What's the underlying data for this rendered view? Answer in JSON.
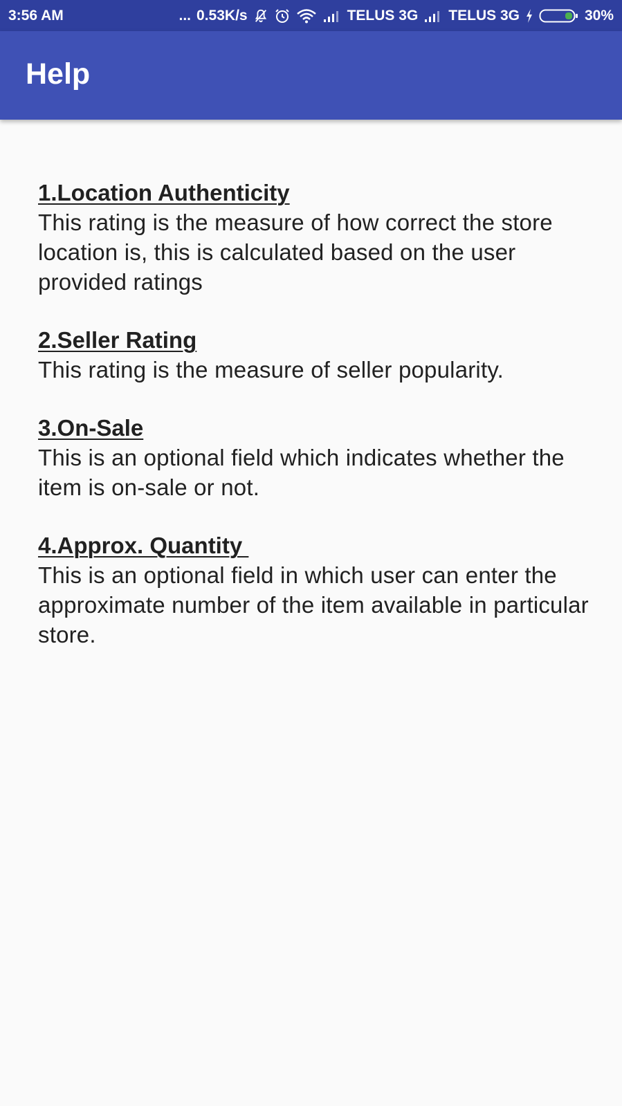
{
  "status_bar": {
    "time": "3:56 AM",
    "dots": "...",
    "net_speed": "0.53K/s",
    "carrier1": "TELUS 3G",
    "carrier2": "TELUS 3G",
    "battery": "30%",
    "icons": [
      "bell-off-icon",
      "alarm-icon",
      "wifi-icon",
      "signal-icon",
      "signal-icon",
      "charging-icon",
      "battery-icon"
    ]
  },
  "app_bar": {
    "title": "Help"
  },
  "sections": [
    {
      "title": "1.Location Authenticity",
      "body": "This rating is the measure of how correct the store location is, this is calculated based on the user provided ratings"
    },
    {
      "title": "2.Seller Rating",
      "body": "This rating is the measure of seller popularity."
    },
    {
      "title": "3.On-Sale",
      "body": "This is an optional field which indicates whether the item is on-sale or not."
    },
    {
      "title": "4.Approx. Quantity ",
      "body": "This is an optional field in which user can enter the approximate number of the item available in particular store."
    }
  ],
  "colors": {
    "status_bar": "#2f3f9e",
    "app_bar": "#3f51b5",
    "background": "#fafafa",
    "text": "#212121",
    "battery_fill": "#4caf50"
  }
}
